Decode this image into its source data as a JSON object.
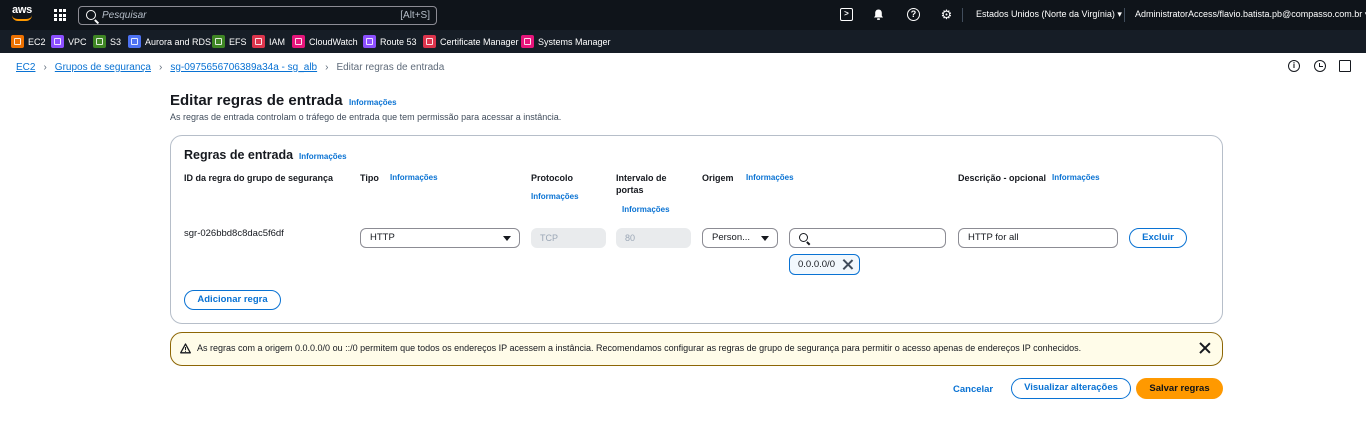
{
  "topnav": {
    "logo_text": "aws",
    "search_placeholder": "Pesquisar",
    "search_shortcut": "[Alt+S]",
    "region": "Estados Unidos (Norte da Virgínia) ▾",
    "account": "AdministratorAccess/flavio.batista.pb@compasso.com.br ▾"
  },
  "favorites": [
    {
      "label": "EC2",
      "color": "#ed7100"
    },
    {
      "label": "VPC",
      "color": "#8c4fff"
    },
    {
      "label": "S3",
      "color": "#3f8624"
    },
    {
      "label": "Aurora and RDS",
      "color": "#4d72f3"
    },
    {
      "label": "EFS",
      "color": "#3f8624"
    },
    {
      "label": "IAM",
      "color": "#dd344c"
    },
    {
      "label": "CloudWatch",
      "color": "#e7157b"
    },
    {
      "label": "Route 53",
      "color": "#8c4fff"
    },
    {
      "label": "Certificate Manager",
      "color": "#dd344c"
    },
    {
      "label": "Systems Manager",
      "color": "#e7157b"
    }
  ],
  "breadcrumb": {
    "items": [
      "EC2",
      "Grupos de segurança",
      "sg-0975656706389a34a - sg_alb"
    ],
    "current": "Editar regras de entrada"
  },
  "page": {
    "title": "Editar regras de entrada",
    "info": "Informações",
    "description": "As regras de entrada controlam o tráfego de entrada que tem permissão para acessar a instância."
  },
  "rules": {
    "title": "Regras de entrada",
    "info": "Informações",
    "columns": {
      "id": "ID da regra do grupo de segurança",
      "type": "Tipo",
      "protocol": "Protocolo",
      "port_range_1": "Intervalo de",
      "port_range_2": "portas",
      "source": "Origem",
      "description": "Descrição - opcional"
    },
    "row": {
      "id": "sgr-026bbd8c8dac5f6df",
      "type": "HTTP",
      "protocol": "TCP",
      "port_range": "80",
      "source_type": "Person...",
      "cidr_token": "0.0.0.0/0",
      "description": "HTTP for all",
      "delete_label": "Excluir"
    },
    "add_label": "Adicionar regra"
  },
  "warning": {
    "text": "As regras com a origem 0.0.0.0/0 ou ::/0 permitem que todos os endereços IP acessem a instância. Recomendamos configurar as regras de grupo de segurança para permitir o acesso apenas de endereços IP conhecidos."
  },
  "actions": {
    "cancel": "Cancelar",
    "preview": "Visualizar alterações",
    "save": "Salvar regras"
  },
  "colors": {
    "accent": "#0972d3",
    "primary_button": "#ff9900",
    "topnav_bg": "#0f141a",
    "warning_border": "#8d6605"
  }
}
